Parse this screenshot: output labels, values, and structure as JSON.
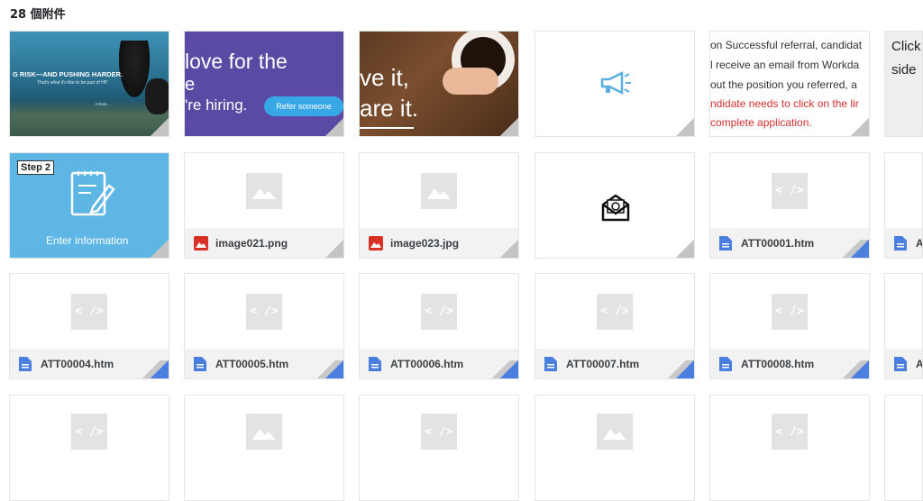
{
  "header": {
    "attachment_count": "28 個附件"
  },
  "row1": {
    "diver": {
      "headline": "G RISK—AND PUSHING HARDER.",
      "sub": "That's what it's like to be part of HP.",
      "tiny": "Inhale..."
    },
    "purple": {
      "line1": "love for the",
      "line2": "e",
      "line3": "'re hiring.",
      "button": "Refer someone"
    },
    "coffee": {
      "line1": "ve it,",
      "line2": "are it."
    },
    "announce": {
      "icon": "megaphone-icon"
    },
    "referral": {
      "line1": "on Successful referral, candidat",
      "line2": "l receive an email from Workda",
      "line3": "out the position you referred, a",
      "line4": "ndidate needs to click on the lir",
      "line5": "complete application."
    },
    "click": {
      "line1": "Click",
      "line2": "side"
    }
  },
  "row2": {
    "step": {
      "badge": "Step 2",
      "caption": "Enter information"
    },
    "files": [
      {
        "name": "image021.png",
        "type": "image"
      },
      {
        "name": "image023.jpg",
        "type": "image"
      }
    ],
    "mail": {
      "icon": "mail-open-icon"
    },
    "htm1": {
      "name": "ATT00001.htm",
      "type": "doc"
    },
    "partial": {
      "name": "A",
      "type": "doc"
    }
  },
  "row3": {
    "files": [
      {
        "name": "ATT00004.htm"
      },
      {
        "name": "ATT00005.htm"
      },
      {
        "name": "ATT00006.htm"
      },
      {
        "name": "ATT00007.htm"
      },
      {
        "name": "ATT00008.htm"
      }
    ],
    "partial": {
      "name": "A"
    }
  },
  "placeholder_code": "< />",
  "colors": {
    "doc_blue": "#4a7fe0",
    "img_red": "#d93025",
    "step_blue": "#5eb6e4",
    "purple": "#5a4aa3",
    "red_text": "#d32f2f"
  }
}
